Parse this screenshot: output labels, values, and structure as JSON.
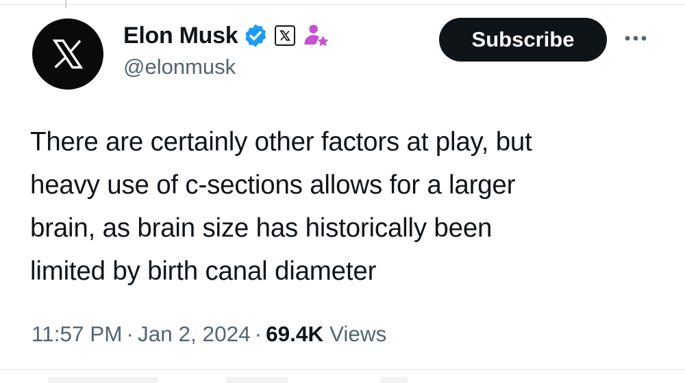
{
  "author": {
    "name": "Elon Musk",
    "handle": "@elonmusk",
    "avatar_icon": "x-logo-icon",
    "badges": [
      "verified-badge-icon",
      "x-affiliate-badge-icon",
      "affiliate-person-icon"
    ],
    "verified_color": "#1d9bf0",
    "affiliate_color": "#c94fd6"
  },
  "actions": {
    "subscribe_label": "Subscribe",
    "more_icon": "more-icon"
  },
  "tweet": {
    "lines": [
      "There are certainly other factors at play, but",
      "heavy use of c-sections allows for a larger",
      "brain, as brain size has historically been",
      "limited by birth canal diameter"
    ]
  },
  "meta": {
    "time": "11:57 PM",
    "separator": "·",
    "date": "Jan 2, 2024",
    "views_count": "69.4K",
    "views_label": "Views"
  }
}
